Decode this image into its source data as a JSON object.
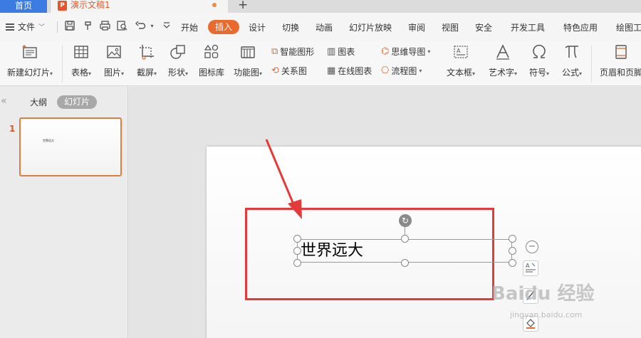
{
  "tabs": {
    "home": "首页",
    "doc_icon": "P",
    "doc_title": "演示文稿1",
    "new_tab": "+"
  },
  "menu": {
    "file": "文件",
    "file_caret": "﹀",
    "caret": "▾",
    "items": [
      "开始",
      "插入",
      "设计",
      "切换",
      "动画",
      "幻灯片放映",
      "审阅",
      "视图",
      "安全",
      "开发工具",
      "特色应用",
      "绘图工"
    ],
    "active": "插入"
  },
  "ribbon": {
    "new_slide": "新建幻灯片",
    "table": "表格",
    "picture": "图片",
    "screenshot": "截屏",
    "shape": "形状",
    "icon_lib": "图标库",
    "func_graph": "功能图",
    "smart_graph": "智能图形",
    "chart": "图表",
    "mind_map": "思维导图",
    "relation_graph": "关系图",
    "online_chart": "在线图表",
    "flow_chart": "流程图",
    "text_box": "文本框",
    "art_text": "艺术字",
    "symbol": "符号",
    "formula": "公式",
    "header_footer": "页眉和页脚",
    "caret": "▾"
  },
  "left_panel": {
    "collapse": "«",
    "outline": "大纲",
    "slides": "幻灯片",
    "slide_number": "1",
    "thumb_text": "世界远大"
  },
  "slide": {
    "text": "世界远大",
    "rotate": "↻",
    "minus": "−"
  },
  "watermark": {
    "main": "Baidu 经验",
    "sub": "jingyan.baidu.com"
  },
  "colors": {
    "accent": "#ea6a2d",
    "home_tab": "#3c7be0",
    "highlight_box": "#e43a3a"
  }
}
